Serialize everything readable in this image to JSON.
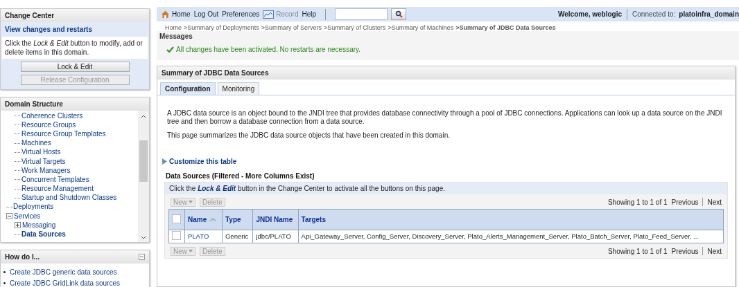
{
  "change_center": {
    "title": "Change Center",
    "link": "View changes and restarts",
    "note": "Click the *Lock & Edit* button to modify, add or delete items in this domain.",
    "buttons": [
      {
        "label": "Lock & Edit",
        "disabled": false
      },
      {
        "label": "Release Configuration",
        "disabled": true
      }
    ]
  },
  "domain_structure": {
    "title": "Domain Structure",
    "tree": [
      {
        "children": [
          {
            "label": "Coherence Clusters",
            "selected": false
          },
          {
            "label": "Resource Groups",
            "selected": false
          },
          {
            "label": "Resource Group Templates",
            "selected": false
          },
          {
            "label": "Machines",
            "selected": false
          },
          {
            "label": "Virtual Hosts",
            "selected": false
          },
          {
            "label": "Virtual Targets",
            "selected": false
          },
          {
            "label": "Work Managers",
            "selected": false
          },
          {
            "label": "Concurrent Templates",
            "selected": false
          },
          {
            "label": "Resource Management",
            "selected": false
          },
          {
            "label": "Startup and Shutdown Classes",
            "selected": false
          }
        ]
      },
      {
        "label": "Deployments",
        "selected": false
      },
      {
        "label": "Services",
        "selected": false,
        "expanded": true,
        "children": [
          {
            "label": "Messaging",
            "selected": false,
            "expanded": false
          },
          {
            "label": "Data Sources",
            "selected": true
          }
        ]
      }
    ]
  },
  "how_do_i": {
    "title": "How do I...",
    "links": [
      "Create JDBC generic data sources",
      "Create JDBC GridLink data sources"
    ]
  },
  "toolbar": {
    "links": [
      {
        "label": "Home",
        "kind": "home",
        "disabled": false
      },
      {
        "label": "Log Out",
        "kind": "text",
        "disabled": false
      },
      {
        "label": "Preferences",
        "kind": "text",
        "disabled": false
      },
      {
        "label": "Record",
        "kind": "chart",
        "disabled": true
      },
      {
        "label": "Help",
        "kind": "text",
        "disabled": false
      }
    ],
    "welcome": "Welcome, weblogic",
    "connected_label": "Connected to:",
    "domain": "platoinfra_domain"
  },
  "breadcrumb": [
    "Home",
    ">Summary of Deployments",
    ">Summary of Servers",
    ">Summary of Clusters",
    ">Summary of Machines",
    ">Summary of JDBC Data Sources"
  ],
  "messages": {
    "title": "Messages",
    "text": "All changes have been activated. No restarts are necessary."
  },
  "summary": {
    "title": "Summary of JDBC Data Sources",
    "tabs": [
      {
        "label": "Configuration",
        "selected": true
      },
      {
        "label": "Monitoring",
        "selected": false
      }
    ],
    "paragraphs": [
      "A JDBC data source is an object bound to the JNDI tree that provides database connectivity through a pool of JDBC connections. Applications can look up a data source on the JNDI tree and then borrow a database connection from a data source.",
      "This page summarizes the JDBC data source objects that have been created in this domain."
    ],
    "customize": "Customize this table",
    "table": {
      "title": "Data Sources (Filtered - More Columns Exist)",
      "hint": "Click the **Lock & Edit** button in the Change Center to activate all the buttons on this page.",
      "bars": [
        {
          "buttons": [
            {
              "label": "New",
              "disabled": true
            },
            {
              "label": "Delete",
              "disabled": true
            }
          ],
          "pager": {
            "showing": "Showing 1 to 1 of 1",
            "previous": "Previous",
            "next": "Next"
          }
        },
        {
          "buttons": [
            {
              "label": "New",
              "disabled": true
            },
            {
              "label": "Delete",
              "disabled": true
            }
          ],
          "pager": {
            "showing": "Showing 1 to 1 of 1",
            "previous": "Previous",
            "next": "Next"
          }
        }
      ],
      "all_checked": false,
      "columns": [
        "Name",
        "Type",
        "JNDI Name",
        "Targets"
      ],
      "rows": [
        {
          "checked": false,
          "cells": [
            "PLATO",
            "Generic",
            "jdbc/PLATO",
            "Api_Gateway_Server, Config_Server, Discovery_Server, Plato_Alerts_Management_Server, Plato_Batch_Server, Plato_Feed_Server, ..."
          ]
        }
      ]
    }
  }
}
